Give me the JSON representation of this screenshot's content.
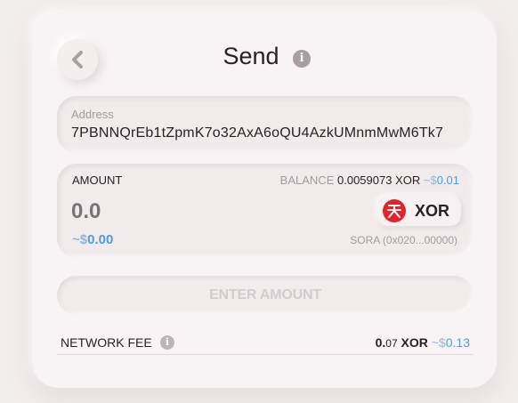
{
  "header": {
    "title": "Send",
    "back_icon": "chevron-left-icon",
    "info_icon": "info-icon"
  },
  "address": {
    "label": "Address",
    "value": "7PBNNQrEb1tZpmK7o32AxA6oQU4AzkUMnmMwM6Tk7"
  },
  "amount": {
    "label": "AMOUNT",
    "balance_label": "BALANCE",
    "balance_value": "0.0059073 XOR",
    "balance_fiat_sign": "~$",
    "balance_fiat_value": "0.01",
    "input_value": "0.0",
    "fiat_sign": "~$",
    "fiat_value": "0.00",
    "token_symbol": "XOR",
    "token_logo": "sora-logo",
    "token_address": "SORA (0x020...00000)"
  },
  "actions": {
    "enter_amount_label": "ENTER AMOUNT"
  },
  "network_fee": {
    "label": "NETWORK FEE",
    "value_whole": "0.",
    "value_fraction": "07",
    "value_symbol": "XOR",
    "fiat_sign": "~$",
    "fiat_value": "0.13"
  },
  "colors": {
    "accent_fiat": "#4d9be0",
    "token_red": "#e3232c"
  }
}
